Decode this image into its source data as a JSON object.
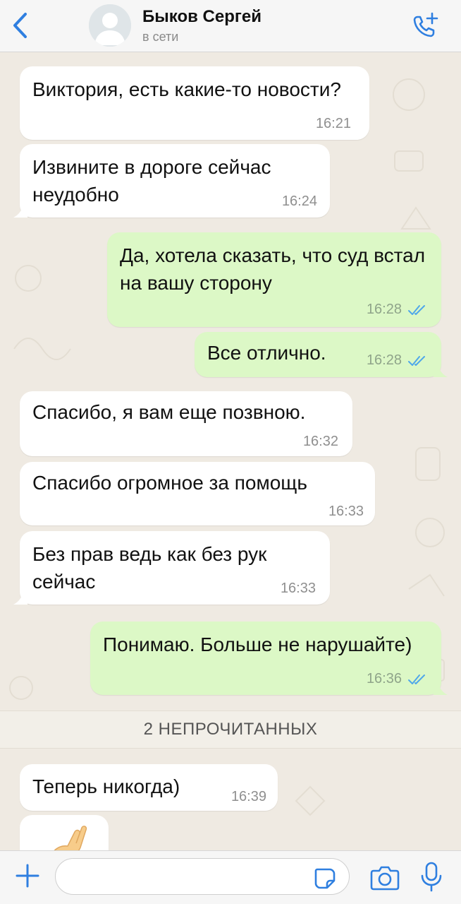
{
  "header": {
    "back_icon": "chevron-left-icon",
    "contact_name": "Быков Сергей",
    "status": "в сети",
    "call_icon": "phone-plus-icon"
  },
  "colors": {
    "accent": "#2f7fe0",
    "incoming_bubble": "#ffffff",
    "outgoing_bubble": "#dcf8c6",
    "read_ticks": "#4fa7ea",
    "wallpaper": "#efeae2"
  },
  "messages": [
    {
      "direction": "incoming",
      "text": "Виктория, есть какие-то новости?",
      "time": "16:21"
    },
    {
      "direction": "incoming",
      "text": "Извините в дороге сейчас неудобно",
      "time": "16:24"
    },
    {
      "direction": "outgoing",
      "text": "Да, хотела сказать, что суд встал на вашу сторону",
      "time": "16:28",
      "status": "read"
    },
    {
      "direction": "outgoing",
      "text": "Все отлично.",
      "time": "16:28",
      "status": "read"
    },
    {
      "direction": "incoming",
      "text": "Спасибо, я вам еще позвною.",
      "time": "16:32"
    },
    {
      "direction": "incoming",
      "text": "Спасибо огромное за помощь",
      "time": "16:33"
    },
    {
      "direction": "incoming",
      "text": "Без прав ведь как без рук сейчас",
      "time": "16:33"
    },
    {
      "direction": "outgoing",
      "text": "Понимаю. Больше не нарушайте)",
      "time": "16:36",
      "status": "read"
    },
    {
      "direction": "incoming",
      "text": "Теперь никогда)",
      "time": "16:39"
    },
    {
      "direction": "incoming",
      "type": "emoji",
      "icon": "crossed-fingers-emoji-icon"
    }
  ],
  "unread_divider": "2 НЕПРОЧИТАННЫХ",
  "input": {
    "placeholder": "",
    "value": "",
    "plus_icon": "plus-icon",
    "sticker_icon": "sticker-icon",
    "camera_icon": "camera-icon",
    "mic_icon": "microphone-icon"
  }
}
